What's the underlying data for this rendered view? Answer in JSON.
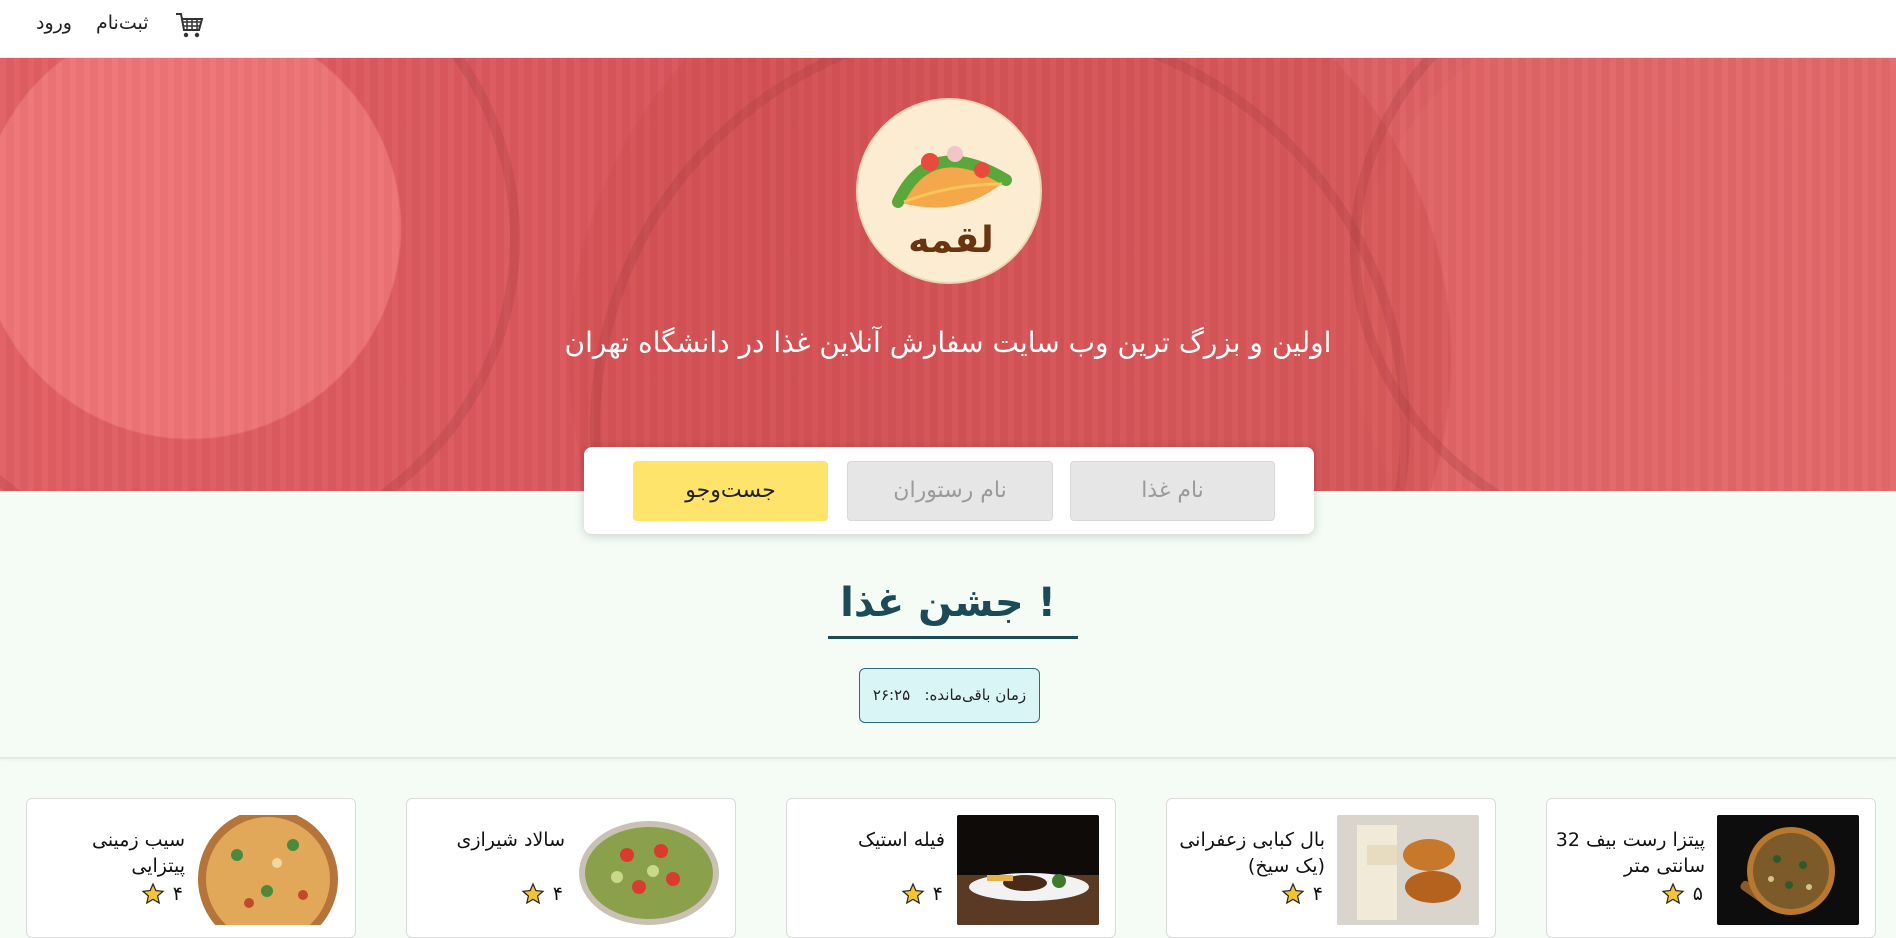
{
  "nav": {
    "login": "ورود",
    "signup": "ثبت‌نام",
    "cart_icon": "cart-icon"
  },
  "hero": {
    "logo_text": "لقمه",
    "tagline": "اولین و بزرگ ترین وب سایت سفارش آنلاین غذا در دانشگاه تهران"
  },
  "search": {
    "food_placeholder": "نام غذا",
    "restaurant_placeholder": "نام رستوران",
    "button_label": "جست‌وجو"
  },
  "festival": {
    "title": "جشن غذا !",
    "timer_label": "زمان باقی‌مانده:",
    "timer_value": "۲۶:۲۵"
  },
  "foods": [
    {
      "name": "پیتزا رست بیف 32 سانتی متر",
      "rating": "۵"
    },
    {
      "name": "بال کبابی زعفرانی (یک سیخ)",
      "rating": "۴"
    },
    {
      "name": "فیله استیک",
      "rating": "۴"
    },
    {
      "name": "سالاد شیرازی",
      "rating": "۴"
    },
    {
      "name": "سیب زمینی پیتزایی",
      "rating": "۴"
    }
  ],
  "colors": {
    "accent_yellow": "#ffe46b",
    "title_teal": "#1c4a57",
    "timer_bg": "#d9f5f6",
    "hero_red": "#d9585e"
  }
}
